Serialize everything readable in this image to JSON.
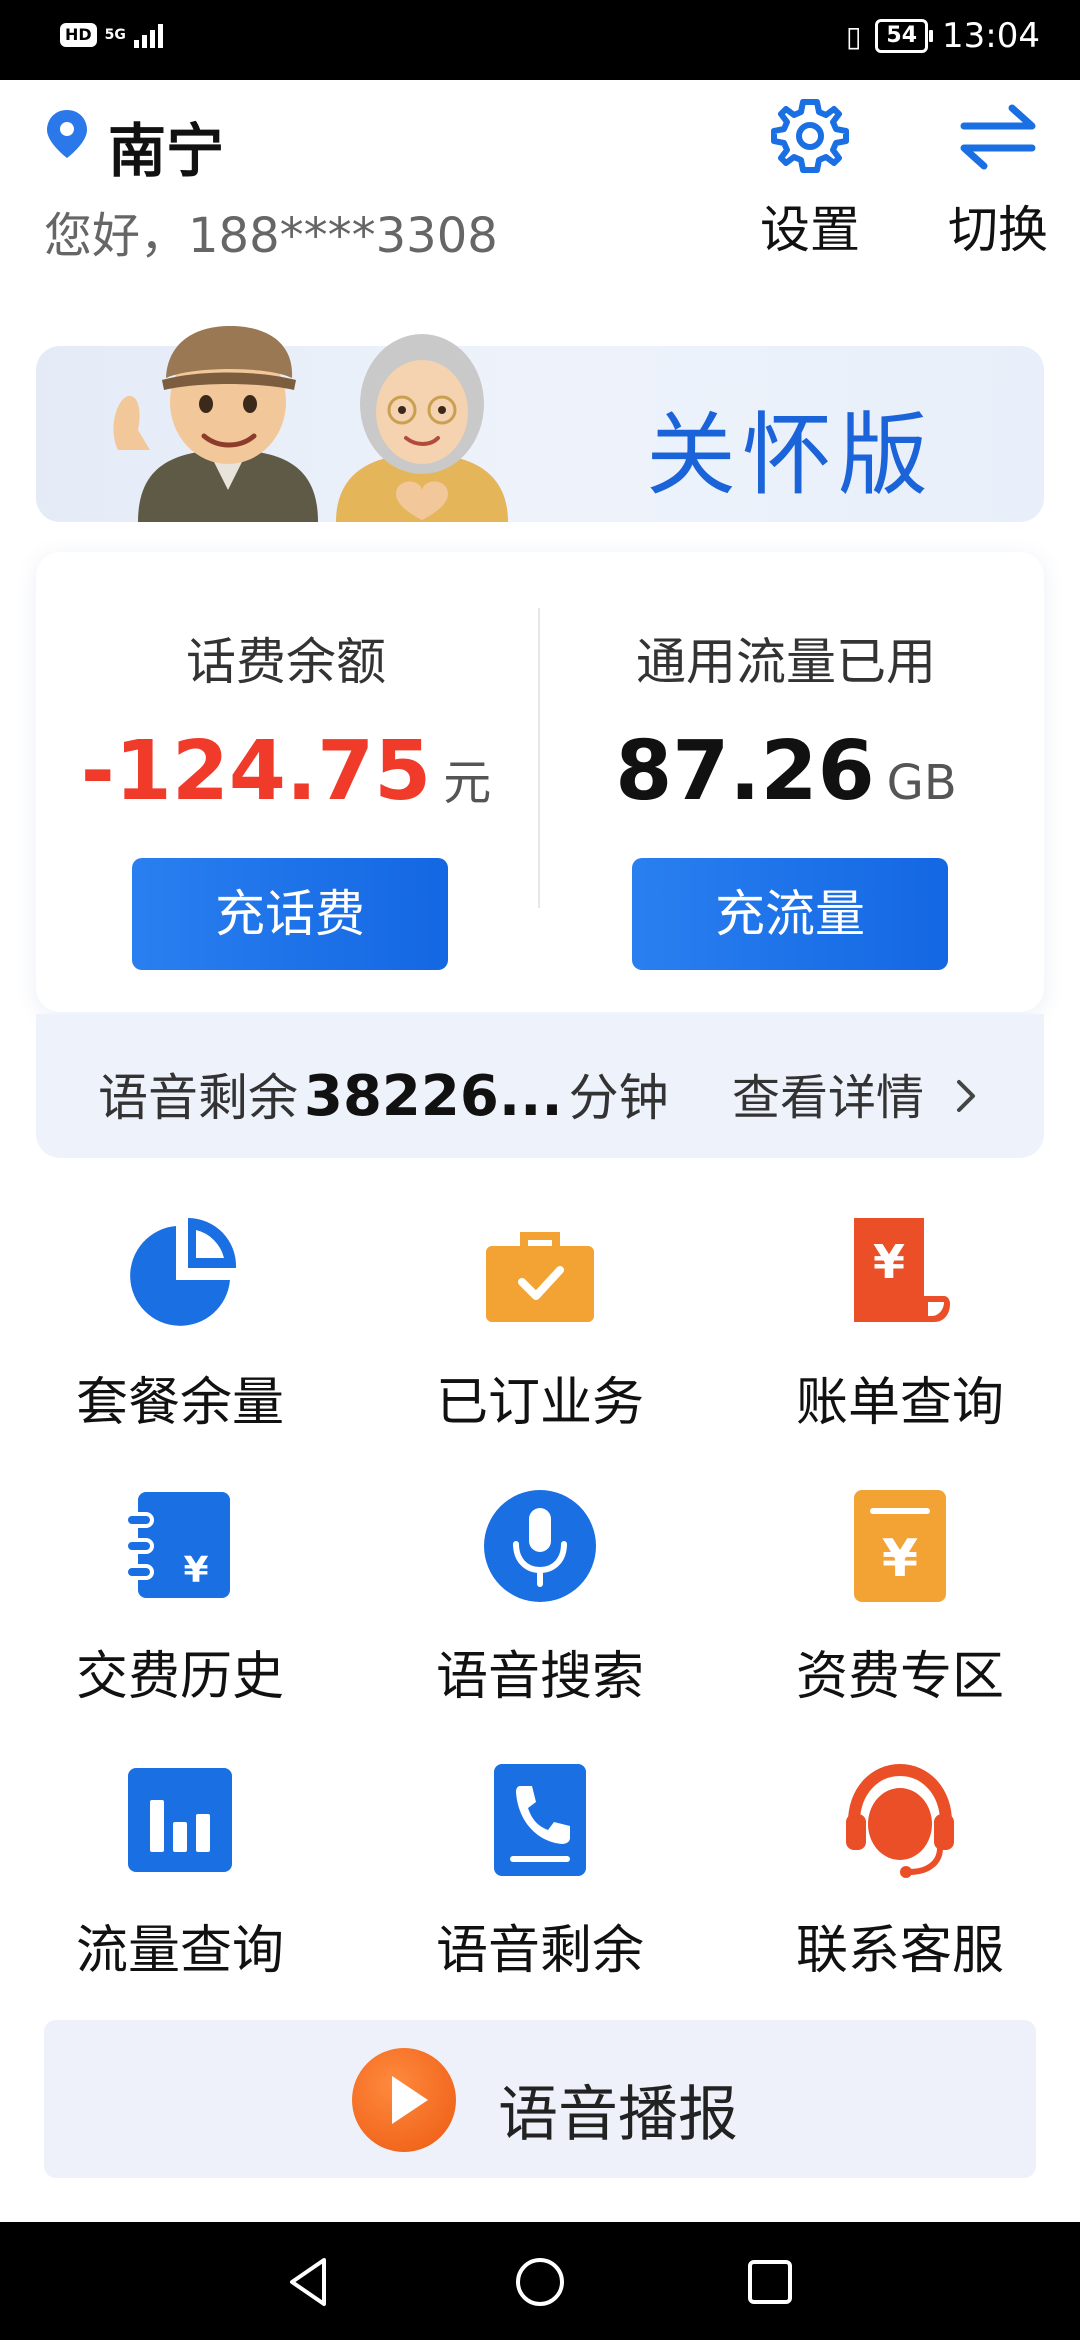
{
  "status_bar": {
    "hd_badge": "HD",
    "network": "5G",
    "battery": "54",
    "time": "13:04"
  },
  "header": {
    "city": "南宁",
    "greeting": "您好，188****3308",
    "settings_label": "设置",
    "switch_label": "切换"
  },
  "banner": {
    "title": "关怀版"
  },
  "account": {
    "balance_title": "话费余额",
    "balance_value": "-124.75",
    "balance_unit": "元",
    "recharge_button": "充话费",
    "data_title": "通用流量已用",
    "data_value": "87.26",
    "data_unit": "GB",
    "data_button": "充流量",
    "voice_label": "语音剩余",
    "voice_value": "38226...",
    "voice_unit": "分钟",
    "details_link": "查看详情"
  },
  "grid": [
    {
      "label": "套餐余量",
      "icon": "pie-chart-icon",
      "color": "#1a6fe3"
    },
    {
      "label": "已订业务",
      "icon": "briefcase-icon",
      "color": "#f3a234"
    },
    {
      "label": "账单查询",
      "icon": "bill-icon",
      "color": "#ea4f27"
    },
    {
      "label": "交费历史",
      "icon": "notebook-icon",
      "color": "#1a6fe3"
    },
    {
      "label": "语音搜索",
      "icon": "microphone-icon",
      "color": "#1a6fe3"
    },
    {
      "label": "资费专区",
      "icon": "price-tag-icon",
      "color": "#f3a234"
    },
    {
      "label": "流量查询",
      "icon": "bar-chart-icon",
      "color": "#1a6fe3"
    },
    {
      "label": "语音剩余",
      "icon": "phone-icon",
      "color": "#1a6fe3"
    },
    {
      "label": "联系客服",
      "icon": "customer-service-icon",
      "color": "#ea4f27"
    }
  ],
  "broadcast": {
    "label": "语音播报"
  },
  "colors": {
    "accent_blue": "#1a6fe3",
    "negative_red": "#f03b2a",
    "accent_orange": "#f3a234"
  }
}
